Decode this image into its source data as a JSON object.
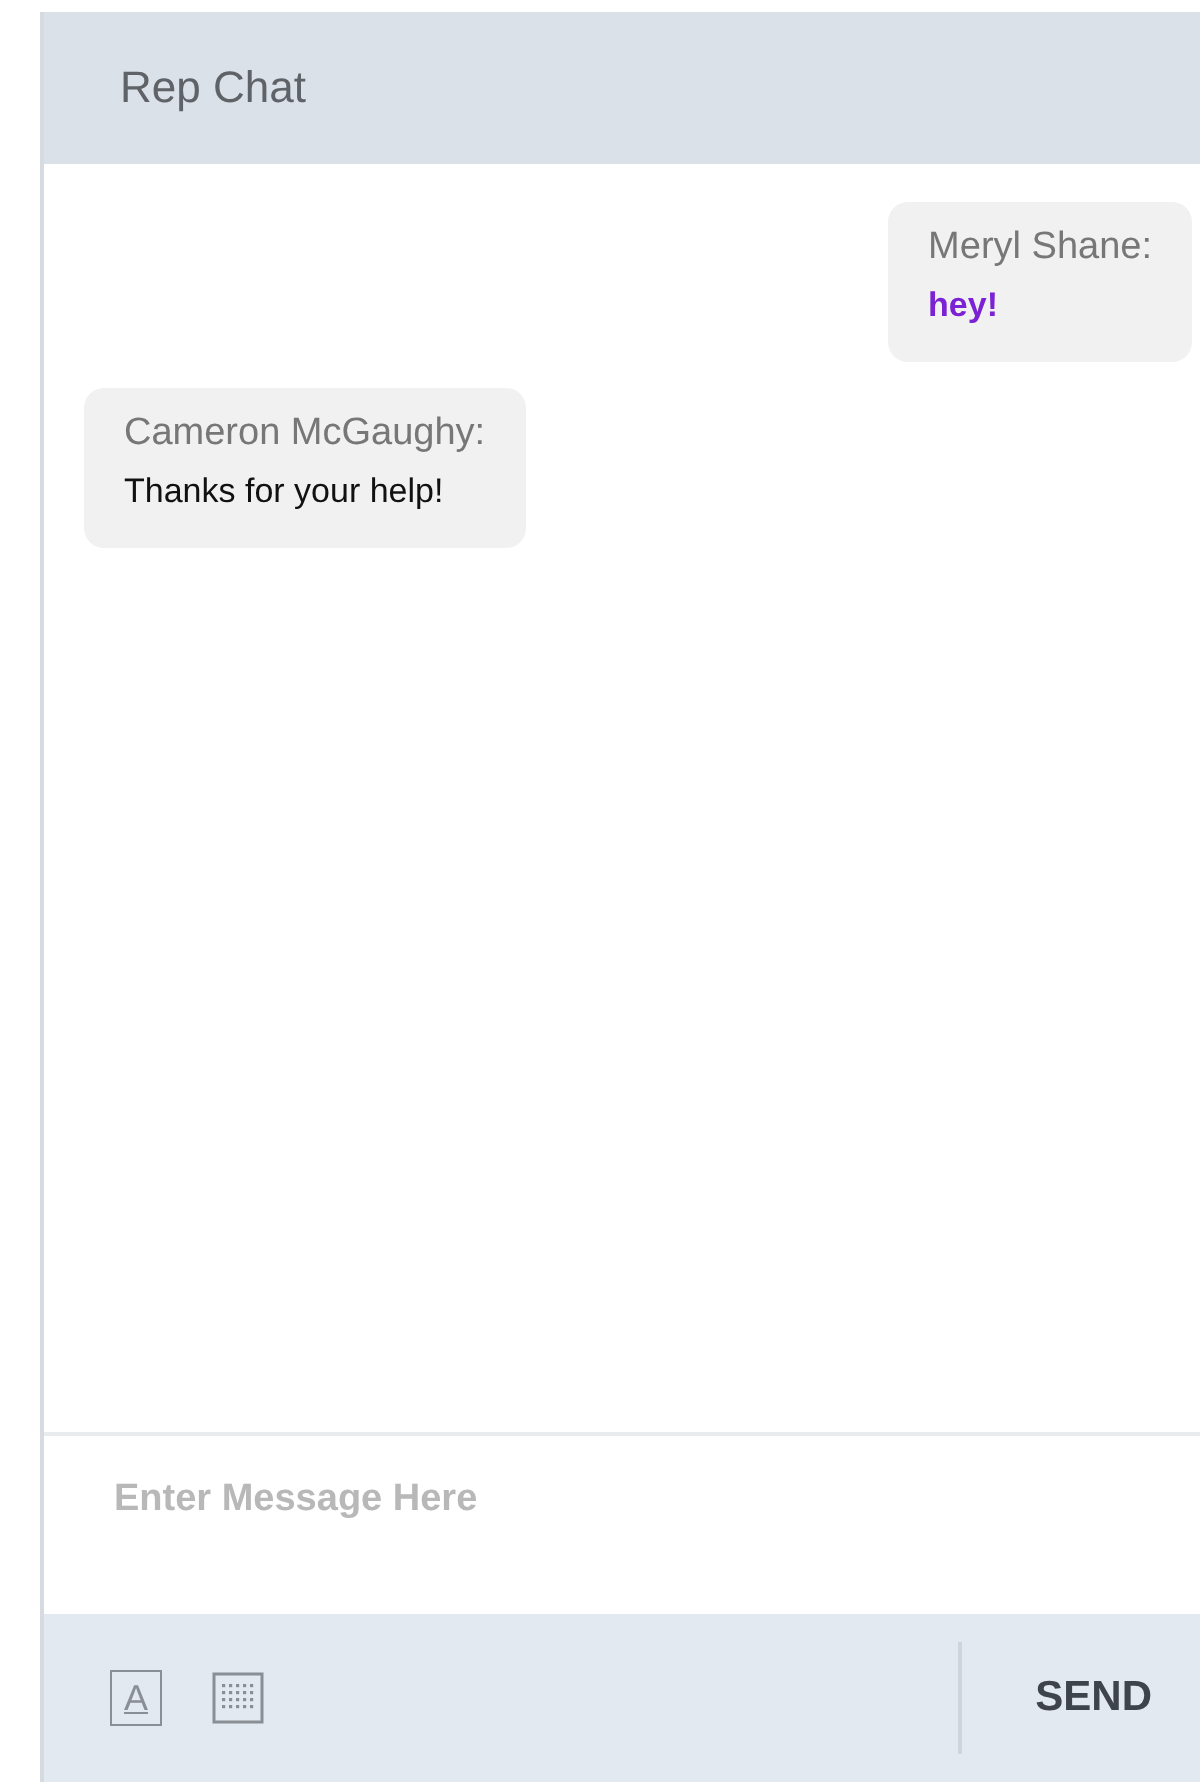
{
  "header": {
    "title": "Rep Chat"
  },
  "messages": [
    {
      "sender": "Meryl Shane:",
      "text": "hey!",
      "kind": "outgoing",
      "bold": true,
      "color": "#7b22d4"
    },
    {
      "sender": "Cameron McGaughy:",
      "text": "Thanks for your help!",
      "kind": "incoming",
      "bold": false,
      "color": "#111111"
    }
  ],
  "input": {
    "placeholder": "Enter Message Here"
  },
  "toolbar": {
    "font_button": "A",
    "send_button": "SEND"
  }
}
